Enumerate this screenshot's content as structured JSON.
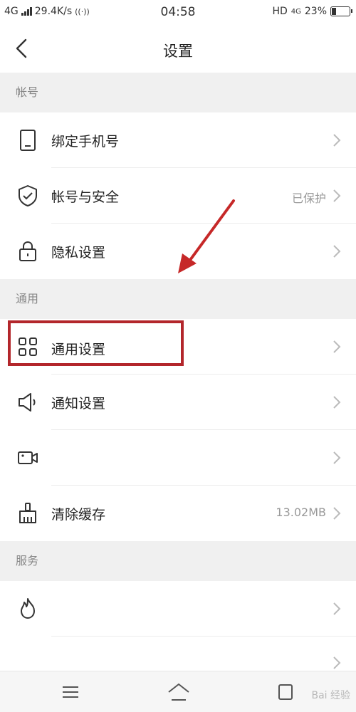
{
  "status_bar": {
    "network": "4G",
    "speed": "29.4K/s",
    "time": "04:58",
    "hd": "HD",
    "hd_net": "4G",
    "battery": "23%",
    "battery_level": 0.23
  },
  "header": {
    "title": "设置"
  },
  "sections": [
    {
      "title": "帐号",
      "items": [
        {
          "label": "绑定手机号",
          "value": "",
          "icon": "phone-icon"
        },
        {
          "label": "帐号与安全",
          "value": "已保护",
          "icon": "shield-check-icon"
        },
        {
          "label": "隐私设置",
          "value": "",
          "icon": "lock-icon"
        }
      ]
    },
    {
      "title": "通用",
      "items": [
        {
          "label": "通用设置",
          "value": "",
          "icon": "grid-icon"
        },
        {
          "label": "通知设置",
          "value": "",
          "icon": "speaker-icon"
        },
        {
          "label": "",
          "value": "",
          "icon": "video-camera-icon"
        },
        {
          "label": "清除缓存",
          "value": "13.02MB",
          "icon": "broom-icon"
        }
      ]
    },
    {
      "title": "服务",
      "items": [
        {
          "label": "",
          "value": "",
          "icon": "flame-icon"
        },
        {
          "label": "",
          "value": "",
          "icon": ""
        }
      ]
    }
  ],
  "annotation": {
    "highlight_color": "#b3262b",
    "arrow_color": "#c62828"
  },
  "watermark": "Bai 经验"
}
